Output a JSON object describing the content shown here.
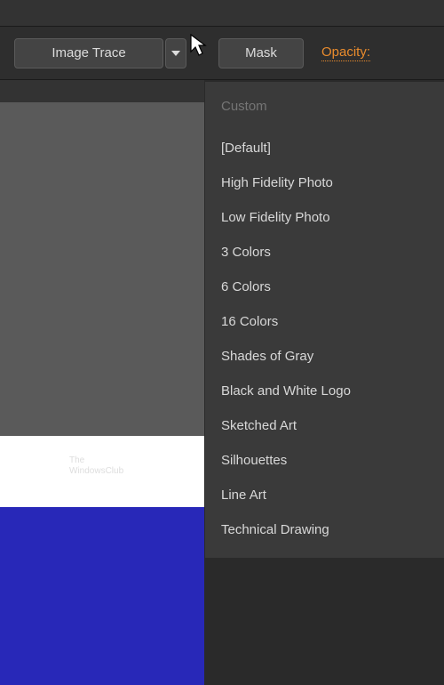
{
  "toolbar": {
    "image_trace_label": "Image Trace",
    "mask_label": "Mask",
    "opacity_label": "Opacity:"
  },
  "dropdown": {
    "custom_label": "Custom",
    "items": [
      "[Default]",
      "High Fidelity Photo",
      "Low Fidelity Photo",
      "3 Colors",
      "6 Colors",
      "16 Colors",
      "Shades of Gray",
      "Black and White Logo",
      "Sketched Art",
      "Silhouettes",
      "Line Art",
      "Technical Drawing"
    ]
  },
  "watermark": {
    "line1": "The",
    "line2": "WindowsClub"
  }
}
